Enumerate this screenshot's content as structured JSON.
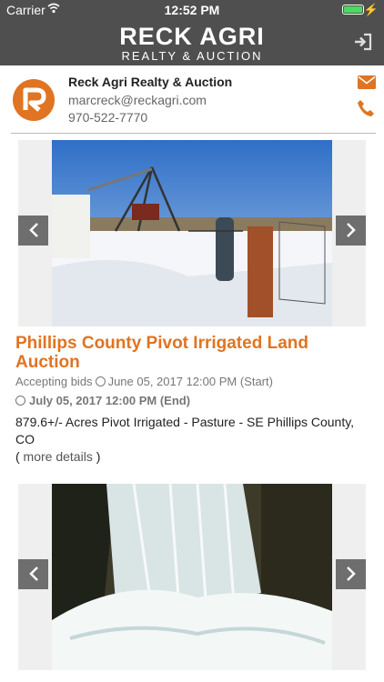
{
  "status_bar": {
    "carrier": "Carrier",
    "time": "12:52 PM"
  },
  "header": {
    "logo_line1": "RECK AGRI",
    "logo_line2": "REALTY & AUCTION"
  },
  "company": {
    "name": "Reck Agri Realty & Auction",
    "email": "marcreck@reckagri.com",
    "phone": "970-522-7770"
  },
  "listings": [
    {
      "title": "Phillips County Pivot Irrigated Land Auction",
      "status": "Accepting bids",
      "start": "June 05, 2017 12:00 PM (Start)",
      "end": "July 05, 2017 12:00 PM (End)",
      "description": "879.6+/- Acres Pivot Irrigated - Pasture - SE Phillips County, CO",
      "more_open": "(",
      "more_link": " more details ",
      "more_close": ")"
    },
    {}
  ],
  "colors": {
    "accent": "#e07422",
    "header_bg": "#4f4f4f"
  },
  "icons": [
    "wifi-icon",
    "battery-icon",
    "login-icon",
    "mail-icon",
    "phone-icon",
    "chevron-left-icon",
    "chevron-right-icon",
    "clock-icon"
  ]
}
